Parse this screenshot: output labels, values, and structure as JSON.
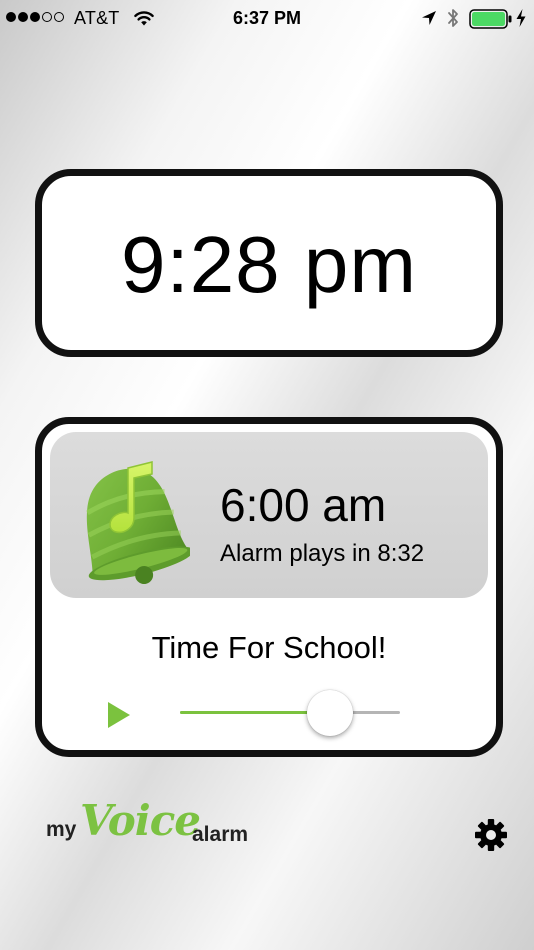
{
  "status_bar": {
    "signal_bars_filled": 3,
    "signal_bars_total": 5,
    "carrier": "AT&T",
    "time": "6:37 PM",
    "battery_level": 1.0,
    "icons": [
      "wifi-icon",
      "location-icon",
      "bluetooth-icon",
      "battery-icon",
      "charging-icon"
    ]
  },
  "current_time": "9:28 pm",
  "alarm": {
    "time": "6:00 am",
    "countdown": "Alarm plays in 8:32",
    "name": "Time For School!",
    "icon": "bell-music-icon",
    "volume": 0.68
  },
  "footer": {
    "logo": {
      "my": "my",
      "voice": "Voice",
      "alarm": "alarm"
    },
    "settings_icon": "gear-icon"
  },
  "colors": {
    "accent": "#7bc23e",
    "card_border": "#111111",
    "summary_bg": "#d5d5d5",
    "battery": "#4cd964"
  }
}
